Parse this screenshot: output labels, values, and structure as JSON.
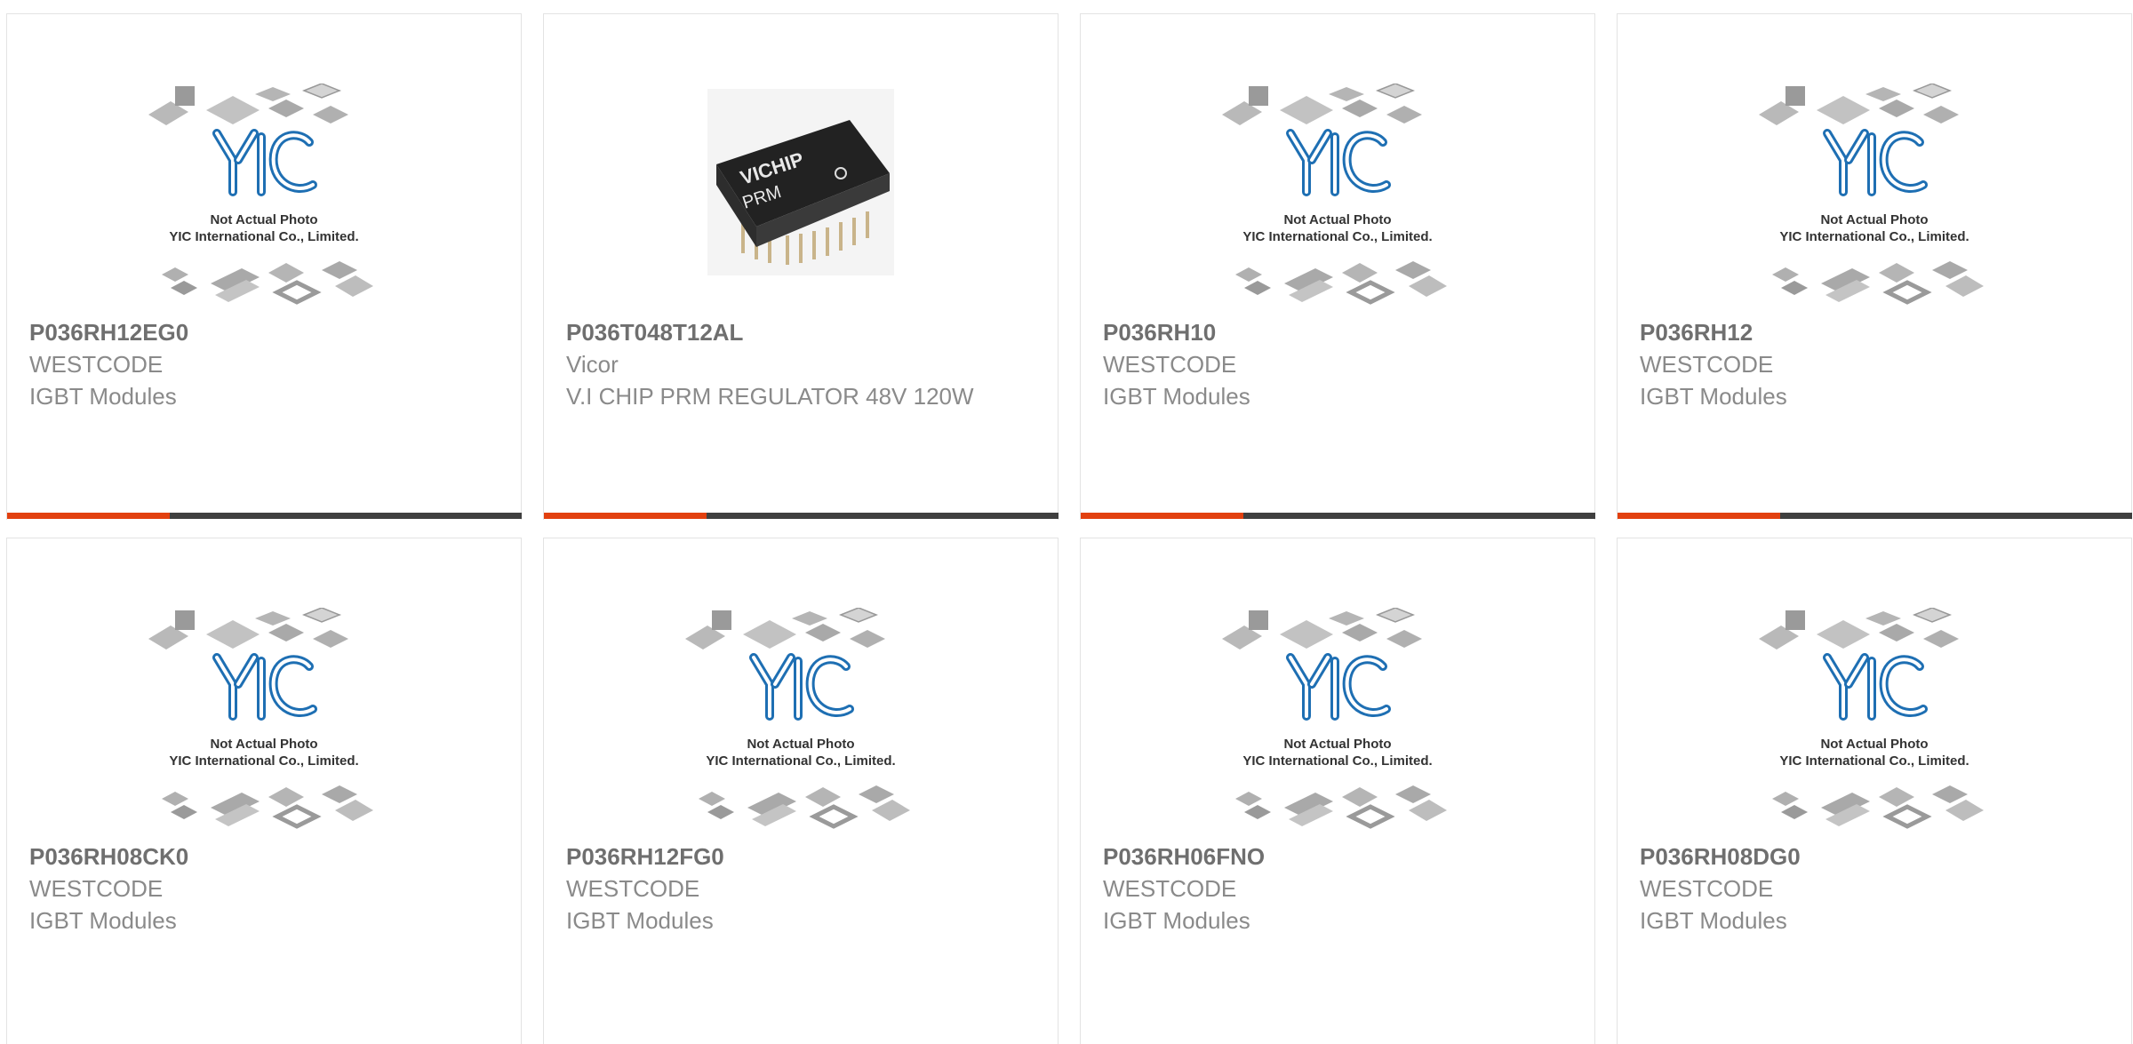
{
  "products": [
    {
      "part_number": "P036RH12EG0",
      "manufacturer": "WESTCODE",
      "description": "IGBT Modules",
      "image": "placeholder",
      "placeholder_caption_1": "Not Actual Photo",
      "placeholder_caption_2": "YIC International Co., Limited.",
      "placeholder_logo": "YIC"
    },
    {
      "part_number": "P036T048T12AL",
      "manufacturer": "Vicor",
      "description": "V.I CHIP PRM REGULATOR 48V 120W",
      "image": "product-photo",
      "photo_brand": "VICHIP",
      "photo_label": "PRM"
    },
    {
      "part_number": "P036RH10",
      "manufacturer": "WESTCODE",
      "description": "IGBT Modules",
      "image": "placeholder",
      "placeholder_caption_1": "Not Actual Photo",
      "placeholder_caption_2": "YIC International Co., Limited.",
      "placeholder_logo": "YIC"
    },
    {
      "part_number": "P036RH12",
      "manufacturer": "WESTCODE",
      "description": "IGBT Modules",
      "image": "placeholder",
      "placeholder_caption_1": "Not Actual Photo",
      "placeholder_caption_2": "YIC International Co., Limited.",
      "placeholder_logo": "YIC"
    },
    {
      "part_number": "P036RH08CK0",
      "manufacturer": "WESTCODE",
      "description": "IGBT Modules",
      "image": "placeholder",
      "placeholder_caption_1": "Not Actual Photo",
      "placeholder_caption_2": "YIC International Co., Limited.",
      "placeholder_logo": "YIC"
    },
    {
      "part_number": "P036RH12FG0",
      "manufacturer": "WESTCODE",
      "description": "IGBT Modules",
      "image": "placeholder",
      "placeholder_caption_1": "Not Actual Photo",
      "placeholder_caption_2": "YIC International Co., Limited.",
      "placeholder_logo": "YIC"
    },
    {
      "part_number": "P036RH06FNO",
      "manufacturer": "WESTCODE",
      "description": "IGBT Modules",
      "image": "placeholder",
      "placeholder_caption_1": "Not Actual Photo",
      "placeholder_caption_2": "YIC International Co., Limited.",
      "placeholder_logo": "YIC"
    },
    {
      "part_number": "P036RH08DG0",
      "manufacturer": "WESTCODE",
      "description": "IGBT Modules",
      "image": "placeholder",
      "placeholder_caption_1": "Not Actual Photo",
      "placeholder_caption_2": "YIC International Co., Limited.",
      "placeholder_logo": "YIC"
    }
  ],
  "colors": {
    "accent": "#e2400f",
    "bar_dark": "#3f3f3f",
    "part_number_text": "#6f6f6f",
    "secondary_text": "#8a8a8a",
    "logo_blue": "#1e6fb3",
    "card_border": "#e3e3e3"
  }
}
